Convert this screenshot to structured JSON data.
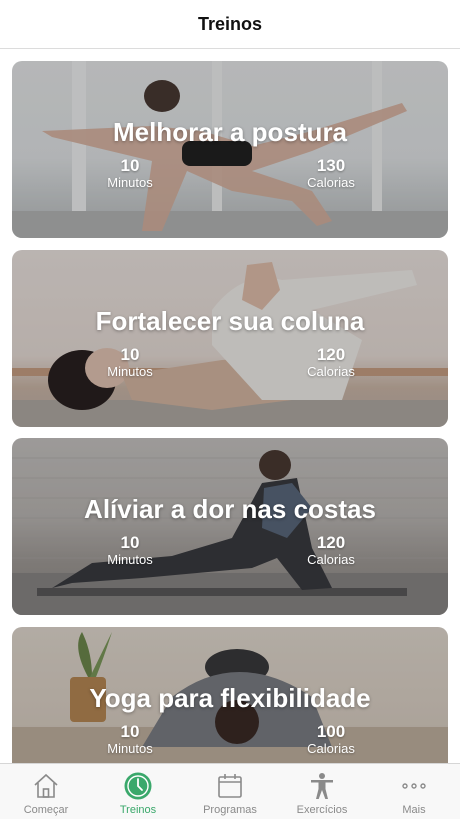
{
  "header": {
    "title": "Treinos"
  },
  "workouts": [
    {
      "title": "Melhorar a postura",
      "minutes": "10",
      "minutes_label": "Minutos",
      "calories": "130",
      "calories_label": "Calorias"
    },
    {
      "title": "Fortalecer sua coluna",
      "minutes": "10",
      "minutes_label": "Minutos",
      "calories": "120",
      "calories_label": "Calorias"
    },
    {
      "title": "Alíviar a dor nas costas",
      "minutes": "10",
      "minutes_label": "Minutos",
      "calories": "120",
      "calories_label": "Calorias"
    },
    {
      "title": "Yoga para flexibilidade",
      "minutes": "10",
      "minutes_label": "Minutos",
      "calories": "100",
      "calories_label": "Calorias"
    }
  ],
  "tabs": [
    {
      "label": "Começar",
      "icon": "home-icon"
    },
    {
      "label": "Treinos",
      "icon": "clock-icon",
      "active": true
    },
    {
      "label": "Programas",
      "icon": "calendar-icon"
    },
    {
      "label": "Exercícios",
      "icon": "person-icon"
    },
    {
      "label": "Mais",
      "icon": "more-icon"
    }
  ],
  "colors": {
    "accent": "#3aa86b",
    "inactive": "#8a8a8a"
  }
}
